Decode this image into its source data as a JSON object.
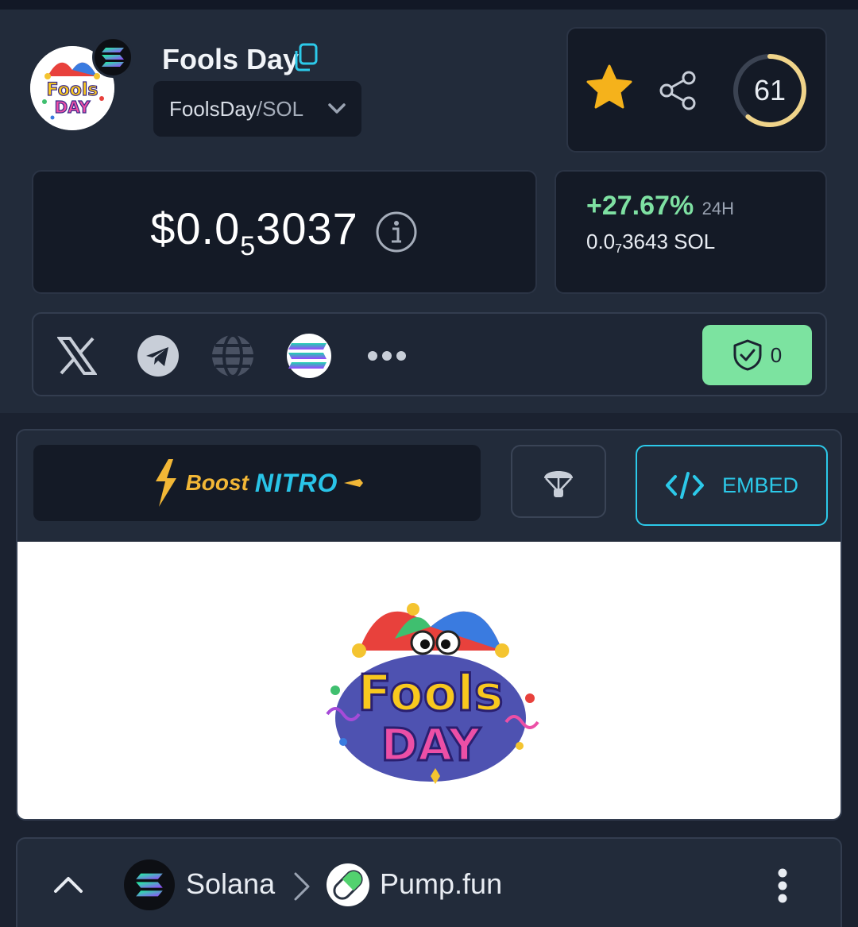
{
  "token": {
    "name": "Fools Day",
    "pair_base": "FoolsDay",
    "pair_sep": " / ",
    "pair_quote": "SOL",
    "logo_text_top": "Fools",
    "logo_text_bottom": "DAY"
  },
  "actions": {
    "score": "61",
    "score_fraction": 0.61
  },
  "price": {
    "usd_prefix": "$0.0",
    "usd_subscript": "5",
    "usd_suffix": "3037"
  },
  "change": {
    "percent": "+27.67%",
    "period": "24H",
    "sol_prefix": "0.0",
    "sol_subscript": "7",
    "sol_suffix": "3643 SOL"
  },
  "links": {
    "audit_count": "0"
  },
  "promo": {
    "boost_label": "Boost",
    "nitro_label": "NITRO",
    "embed_label": "EMBED"
  },
  "breadcrumb": {
    "chain": "Solana",
    "dex": "Pump.fun"
  },
  "colors": {
    "accent_cyan": "#2cc9e9",
    "positive_green": "#7ee0a2",
    "audit_green": "#7ce3a0",
    "star_gold": "#f5b21b"
  }
}
